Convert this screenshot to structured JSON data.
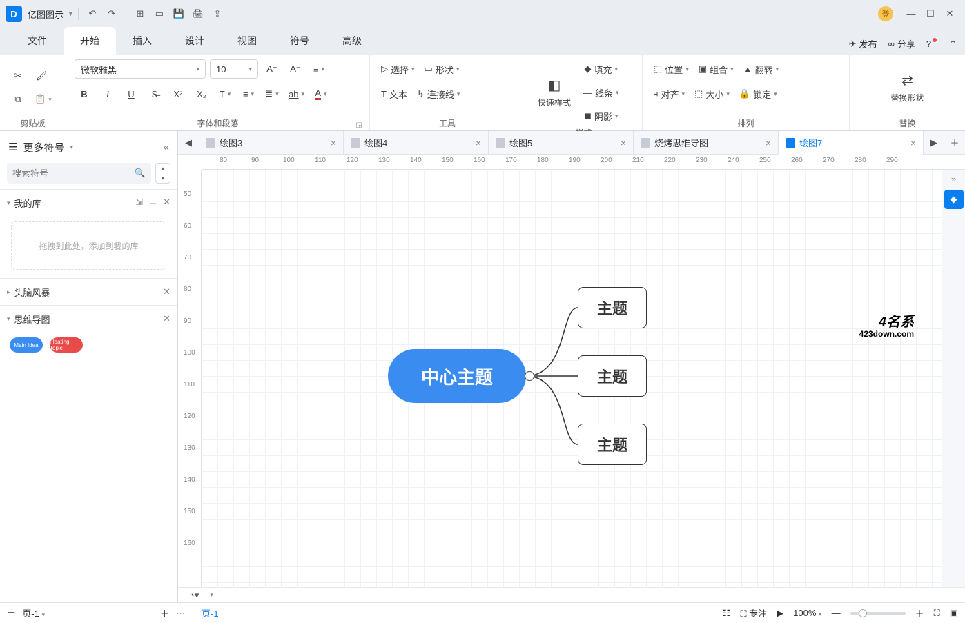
{
  "app": {
    "title": "亿图图示",
    "avatar": "登"
  },
  "menubar": {
    "items": [
      "文件",
      "开始",
      "插入",
      "设计",
      "视图",
      "符号",
      "高级"
    ],
    "active": 1,
    "publish": "发布",
    "share": "分享"
  },
  "ribbon": {
    "clipboard": {
      "label": "剪贴板"
    },
    "font": {
      "label": "字体和段落",
      "family": "微软雅黑",
      "size": "10"
    },
    "tools": {
      "label": "工具",
      "select": "选择",
      "shape": "形状",
      "text": "文本",
      "connector": "连接线"
    },
    "style": {
      "label": "样式",
      "quick": "快速样式",
      "fill": "填充",
      "line": "线条",
      "shadow": "阴影"
    },
    "arrange": {
      "label": "排列",
      "pos": "位置",
      "align": "对齐",
      "group": "组合",
      "size": "大小",
      "flip": "翻转",
      "lock": "锁定"
    },
    "replace": {
      "label": "替换",
      "btn": "替换形状"
    }
  },
  "sidebar": {
    "title": "更多符号",
    "search_placeholder": "搜索符号",
    "sections": {
      "mylib": {
        "title": "我的库",
        "drop": "拖拽到此处，添加到我的库"
      },
      "brainstorm": {
        "title": "头脑风暴"
      },
      "mindmap": {
        "title": "思维导图",
        "thumbs": [
          "Main Idea",
          "Floating Topic"
        ]
      }
    }
  },
  "tabs": [
    {
      "label": "绘图3"
    },
    {
      "label": "绘图4"
    },
    {
      "label": "绘图5"
    },
    {
      "label": "烧烤思维导图"
    },
    {
      "label": "绘图7",
      "active": true
    }
  ],
  "ruler_h": [
    "80",
    "90",
    "100",
    "110",
    "120",
    "130",
    "140",
    "150",
    "160",
    "170",
    "180",
    "190",
    "200",
    "210",
    "220",
    "230",
    "240",
    "250",
    "260",
    "270",
    "280",
    "290"
  ],
  "ruler_v": [
    "50",
    "60",
    "70",
    "80",
    "90",
    "100",
    "110",
    "120",
    "130",
    "140",
    "150",
    "160"
  ],
  "mindmap": {
    "center": "中心主题",
    "sub1": "主题",
    "sub2": "主题",
    "sub3": "主题"
  },
  "colorbar": [
    "#000000",
    "#3d3d3d",
    "#5a5a5a",
    "#7a7a7a",
    "#9a9a9a",
    "#bcbcbc",
    "#d6d6d6",
    "#efefef",
    "#ffffff",
    "#7a0c0c",
    "#a21616",
    "#c62828",
    "#e53935",
    "#ff5722",
    "#ff7043",
    "#ff9800",
    "#ffb300",
    "#ffd54f",
    "#fff176",
    "#cddc39",
    "#9ccc65",
    "#66bb6a",
    "#43a047",
    "#2e7d32",
    "#00897b",
    "#26a69a",
    "#4dd0e1",
    "#29b6f6",
    "#2196f3",
    "#1e88e5",
    "#1565c0",
    "#3949ab",
    "#5c6bc0",
    "#7e57c2",
    "#9575cd",
    "#ab47bc",
    "#ce93d8",
    "#ec407a",
    "#f06292",
    "#f48fb1",
    "#8d6e63",
    "#a1887f",
    "#bcaaa4",
    "#6d4c41",
    "#4e342e",
    "#455a64",
    "#607d8b",
    "#78909c",
    "#90a4ae",
    "#b0bec5",
    "#37474f",
    "#263238",
    "#000",
    "#1a1a1a",
    "#333",
    "#555",
    "#888",
    "#bbb"
  ],
  "status": {
    "page_sel": "页-1",
    "page_active": "页-1",
    "focus": "专注",
    "zoom": "100%"
  },
  "watermark": {
    "l1": "4名系",
    "l2": "423down.com"
  }
}
